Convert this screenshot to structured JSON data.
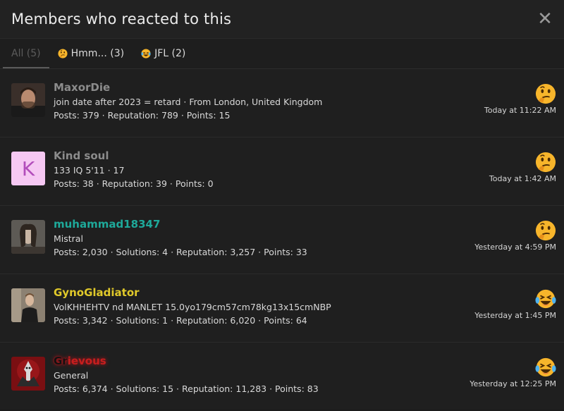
{
  "header": {
    "title": "Members who reacted to this"
  },
  "tabs": [
    {
      "label": "All (5)",
      "emoji": ""
    },
    {
      "label": "Hmm... (3)",
      "emoji": "thinking-emoji"
    },
    {
      "label": "JFL (2)",
      "emoji": "crying-laughing-emoji"
    }
  ],
  "members": [
    {
      "username": "MaxorDie",
      "blurb": "join date after 2023 = retard · From London, United Kingdom",
      "stats": "Posts: 379 · Reputation: 789 · Points: 15",
      "reaction": "thinking-emoji",
      "time": "Today at 11:22 AM",
      "avatar": "photo"
    },
    {
      "username": "Kind soul",
      "blurb": "133 IQ 5'11 · 17",
      "stats": "Posts: 38 · Reputation: 39 · Points: 0",
      "reaction": "thinking-emoji",
      "time": "Today at 1:42 AM",
      "avatar_letter": "K"
    },
    {
      "username": "muhammad18347",
      "blurb": "Mistral",
      "stats": "Posts: 2,030 · Solutions: 4 · Reputation: 3,257 · Points: 33",
      "reaction": "thinking-emoji",
      "time": "Yesterday at 4:59 PM",
      "avatar": "photo"
    },
    {
      "username": "GynoGladiator",
      "blurb": "VolKHHEHTV nd MANLET 15.0yo179cm57cm78kg13x15cmNBP",
      "stats": "Posts: 3,342 · Solutions: 1 · Reputation: 6,020 · Points: 64",
      "reaction": "crying-laughing-emoji",
      "time": "Yesterday at 1:45 PM",
      "avatar": "photo"
    },
    {
      "username_a": "Gr",
      "username_b": "ievous",
      "blurb": "General",
      "stats": "Posts: 6,374 · Solutions: 15 · Reputation: 11,283 · Points: 83",
      "reaction": "crying-laughing-emoji",
      "time": "Yesterday at 12:25 PM",
      "avatar": "photo"
    }
  ],
  "colors": {
    "background": "#1f1f1f",
    "username_default": "#8c8c8c",
    "username_teal": "#1ea99a",
    "username_gold": "#e0c92a",
    "username_red": "#c81e1e",
    "avatar_letter_bg": "#f6c8f3",
    "avatar_letter_fg": "#b24dbb"
  }
}
